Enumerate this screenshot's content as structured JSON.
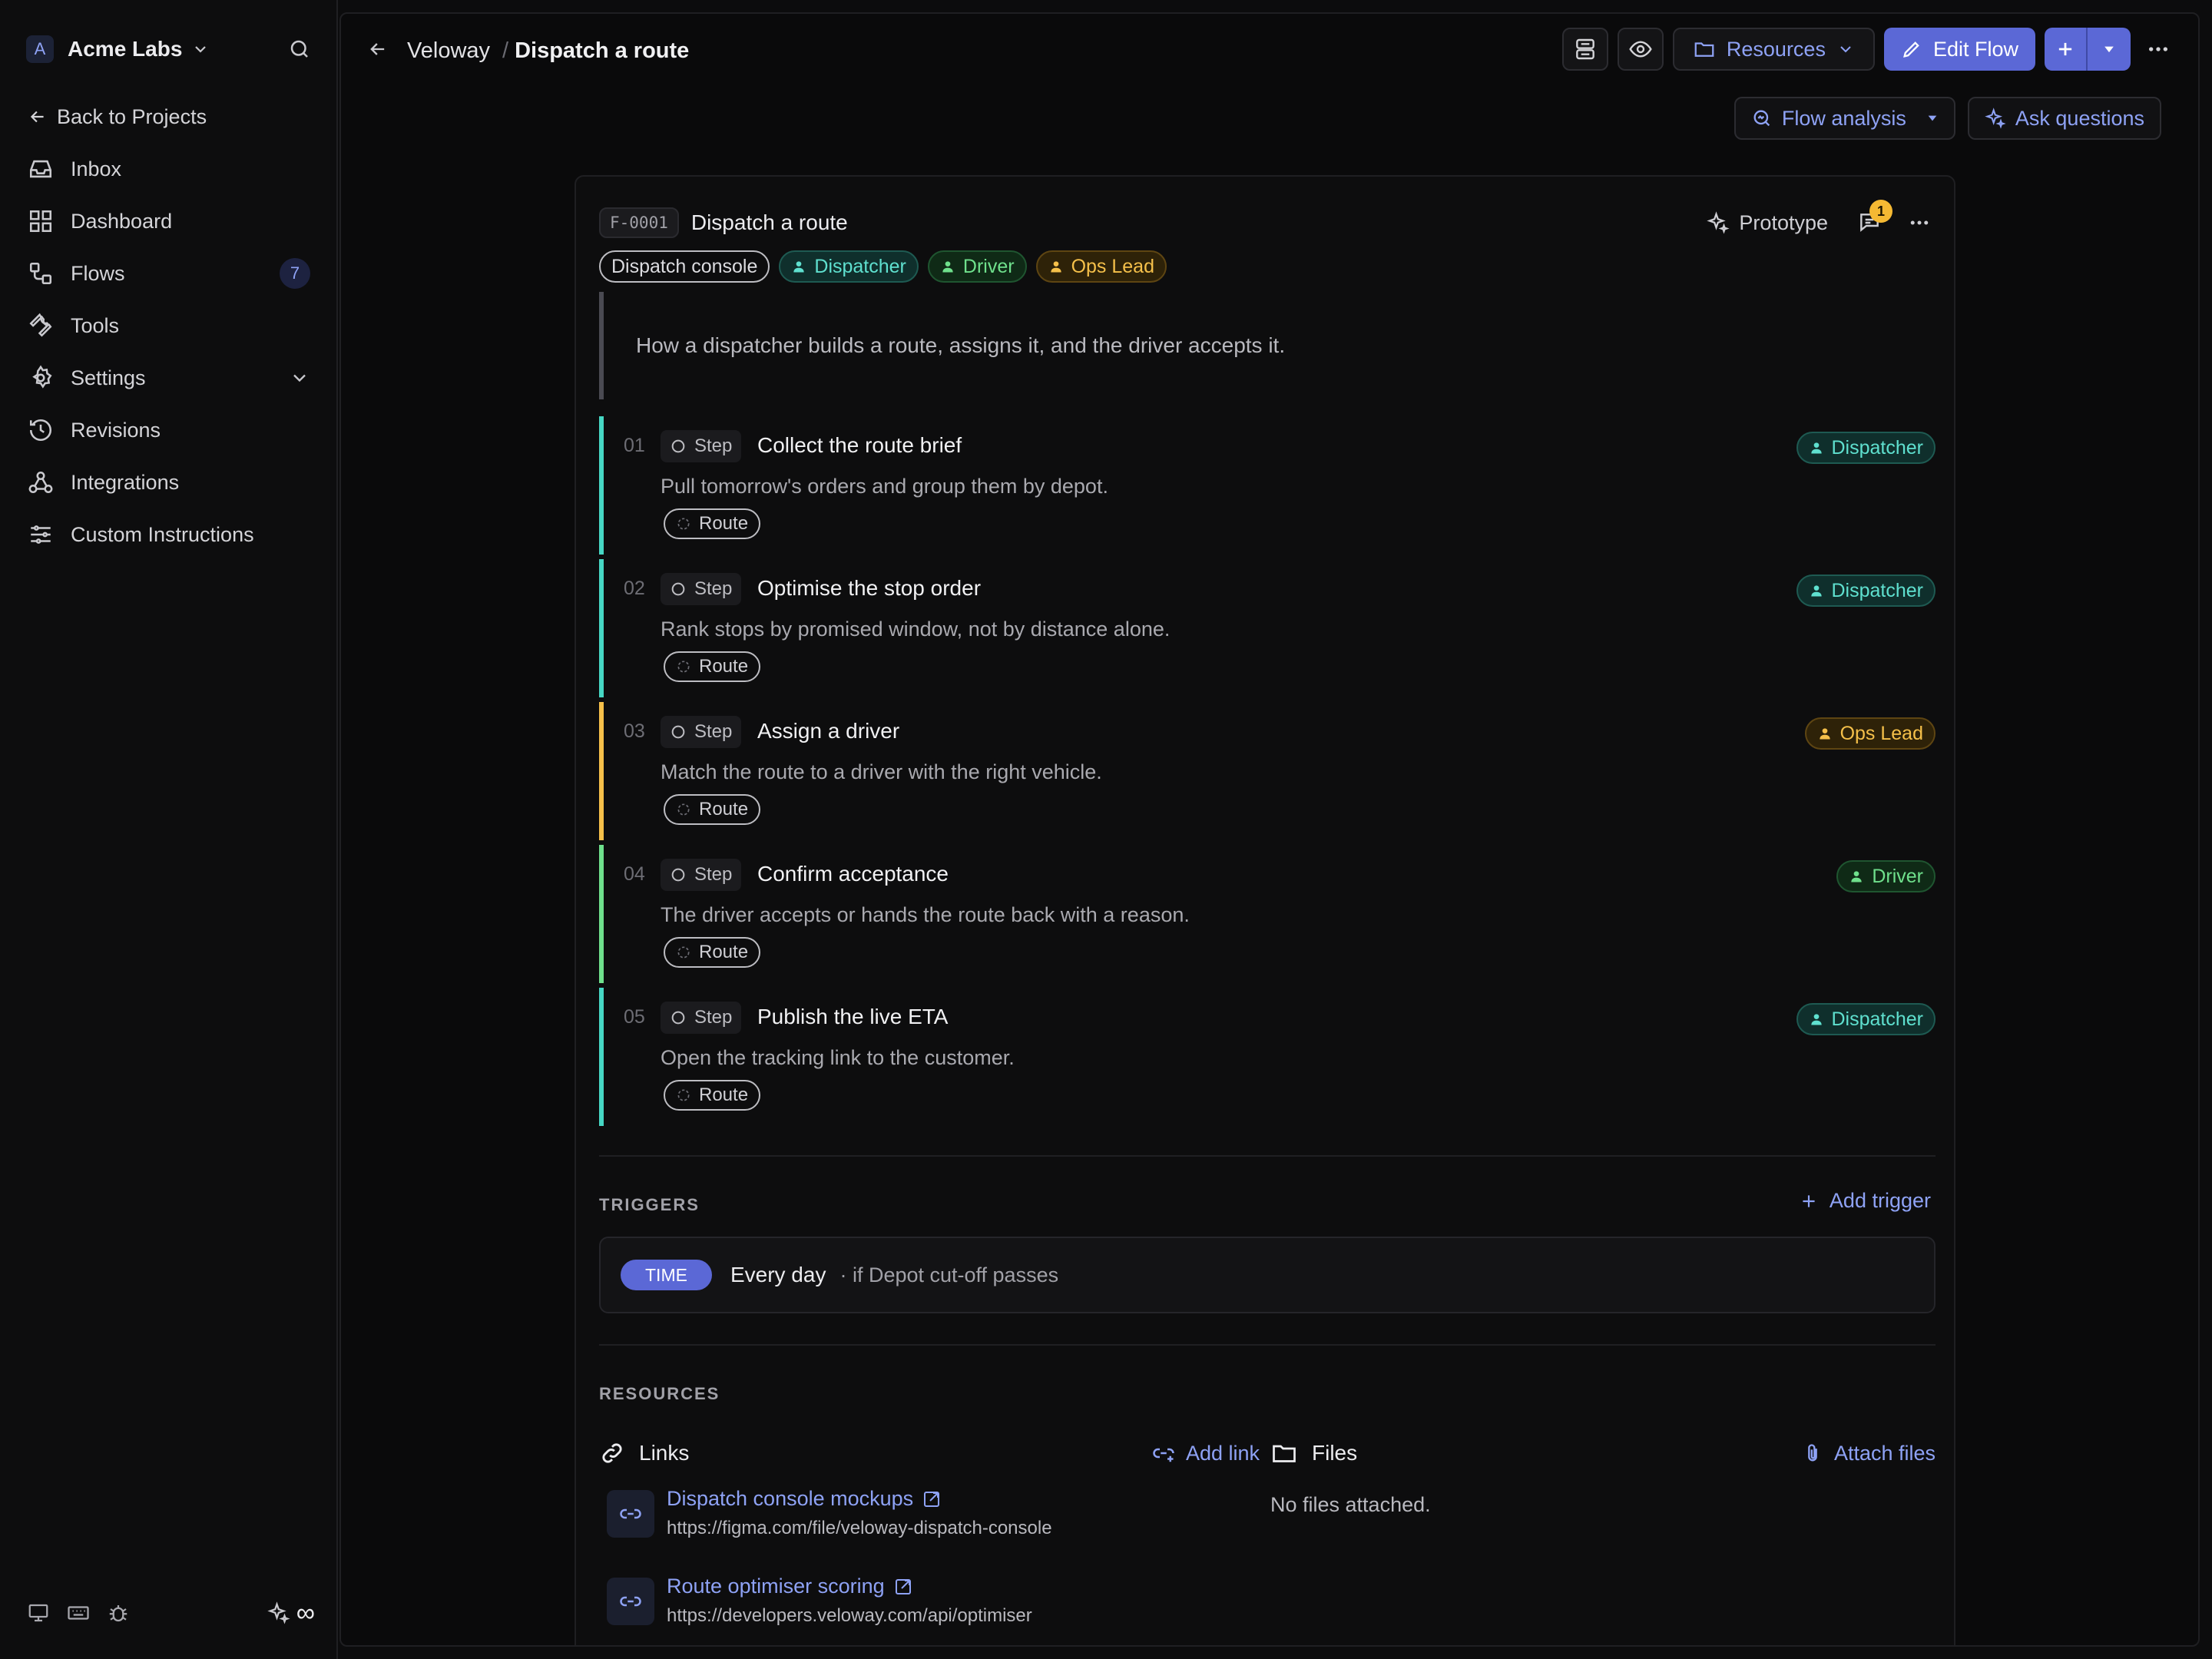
{
  "workspace": {
    "initial": "A",
    "name": "Acme Labs"
  },
  "sidebar": {
    "back_label": "Back to Projects",
    "items": [
      {
        "label": "Inbox",
        "icon": "inbox-icon"
      },
      {
        "label": "Dashboard",
        "icon": "dashboard-icon"
      },
      {
        "label": "Flows",
        "icon": "flows-icon",
        "badge": "7"
      },
      {
        "label": "Tools",
        "icon": "wrench-icon"
      },
      {
        "label": "Settings",
        "icon": "gear-icon"
      },
      {
        "label": "Revisions",
        "icon": "history-icon"
      },
      {
        "label": "Integrations",
        "icon": "webhook-icon"
      },
      {
        "label": "Custom Instructions",
        "icon": "sliders-icon"
      }
    ],
    "footer_right": "∞"
  },
  "breadcrumb": {
    "project": "Veloway",
    "separator": "/",
    "current": "Dispatch a route"
  },
  "toolbar": {
    "resources_label": "Resources",
    "edit_label": "Edit Flow",
    "flow_analysis_label": "Flow analysis",
    "ask_label": "Ask questions"
  },
  "flow": {
    "id": "F-0001",
    "title": "Dispatch a route",
    "prototype_label": "Prototype",
    "comment_count": "1",
    "tags": {
      "surface": "Dispatch console",
      "dispatcher": "Dispatcher",
      "driver": "Driver",
      "ops": "Ops Lead"
    },
    "description": "How a dispatcher builds a route, assigns it, and the driver accepts it.",
    "steps": [
      {
        "num": "01",
        "kind": "Step",
        "title": "Collect the route brief",
        "text": "Pull tomorrow's orders and group them by depot.",
        "route": "Route",
        "role": "Dispatcher",
        "color": "#46d7c4"
      },
      {
        "num": "02",
        "kind": "Step",
        "title": "Optimise the stop order",
        "text": "Rank stops by promised window, not by distance alone.",
        "route": "Route",
        "role": "Dispatcher",
        "color": "#46d7c4"
      },
      {
        "num": "03",
        "kind": "Step",
        "title": "Assign a driver",
        "text": "Match the route to a driver with the right vehicle.",
        "route": "Route",
        "role": "Ops Lead",
        "color": "#f5c04a"
      },
      {
        "num": "04",
        "kind": "Step",
        "title": "Confirm acceptance",
        "text": "The driver accepts or hands the route back with a reason.",
        "route": "Route",
        "role": "Driver",
        "color": "#6fe08c"
      },
      {
        "num": "05",
        "kind": "Step",
        "title": "Publish the live ETA",
        "text": "Open the tracking link to the customer.",
        "route": "Route",
        "role": "Dispatcher",
        "color": "#46d7c4"
      }
    ]
  },
  "triggers": {
    "section_label": "TRIGGERS",
    "add_label": "Add trigger",
    "items": [
      {
        "type": "TIME",
        "main": "Every day",
        "condition": "· if Depot cut-off passes"
      }
    ]
  },
  "resources": {
    "section_label": "RESOURCES",
    "links_label": "Links",
    "add_link_label": "Add link",
    "links": [
      {
        "title": "Dispatch console mockups",
        "url": "https://figma.com/file/veloway-dispatch-console"
      },
      {
        "title": "Route optimiser scoring",
        "url": "https://developers.veloway.com/api/optimiser"
      }
    ],
    "files_label": "Files",
    "attach_label": "Attach files",
    "files_empty": "No files attached."
  }
}
